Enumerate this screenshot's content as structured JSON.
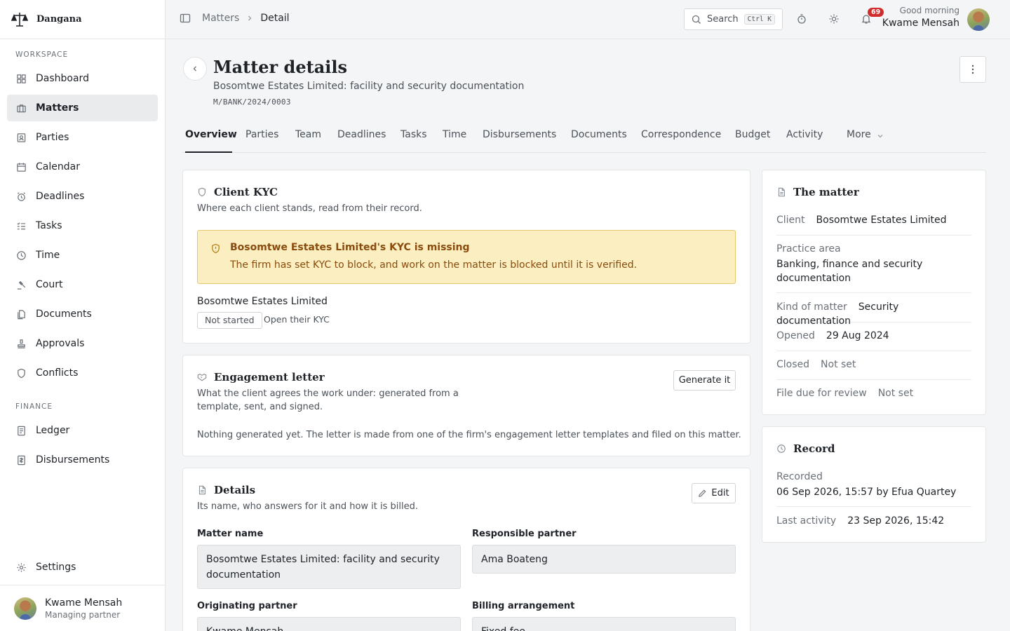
{
  "brand": {
    "name": "Dangana"
  },
  "sidebar": {
    "section_workspace": "WORKSPACE",
    "section_finance": "FINANCE",
    "items": [
      {
        "label": "Dashboard",
        "icon": "grid-icon"
      },
      {
        "label": "Matters",
        "icon": "briefcase-icon"
      },
      {
        "label": "Parties",
        "icon": "contact-icon"
      },
      {
        "label": "Calendar",
        "icon": "calendar-icon"
      },
      {
        "label": "Deadlines",
        "icon": "alarm-icon"
      },
      {
        "label": "Tasks",
        "icon": "list-check-icon"
      },
      {
        "label": "Time",
        "icon": "clock-icon"
      },
      {
        "label": "Court",
        "icon": "gavel-icon"
      },
      {
        "label": "Documents",
        "icon": "documents-icon"
      },
      {
        "label": "Approvals",
        "icon": "stamp-icon"
      },
      {
        "label": "Conflicts",
        "icon": "shield-icon"
      }
    ],
    "finance_items": [
      {
        "label": "Ledger",
        "icon": "ledger-icon"
      },
      {
        "label": "Disbursements",
        "icon": "receipt-icon"
      }
    ],
    "settings_label": "Settings",
    "user": {
      "name": "Kwame Mensah",
      "role": "Managing partner"
    }
  },
  "topbar": {
    "crumb_parent": "Matters",
    "crumb_current": "Detail",
    "search_label": "Search",
    "search_shortcut": "Ctrl K",
    "notification_count": "69",
    "greeting": "Good morning",
    "user_name": "Kwame Mensah"
  },
  "header": {
    "title": "Matter details",
    "subtitle": "Bosomtwe Estates Limited: facility and security documentation",
    "reference": "M/BANK/2024/0003"
  },
  "tabs": [
    "Overview",
    "Parties",
    "Team",
    "Deadlines",
    "Tasks",
    "Time",
    "Disbursements",
    "Documents",
    "Correspondence",
    "Budget",
    "Activity",
    "More"
  ],
  "kyc": {
    "title": "Client KYC",
    "description": "Where each client stands, read from their record.",
    "alert_title": "Bosomtwe Estates Limited's KYC is missing",
    "alert_text": "The firm has set KYC to block, and work on the matter is blocked until it is verified.",
    "client_name": "Bosomtwe Estates Limited",
    "status": "Not started",
    "open_link": "Open their KYC"
  },
  "engagement": {
    "title": "Engagement letter",
    "description_line1": "What the client agrees the work under: generated from a",
    "description_line2": "template, sent, and signed.",
    "generate_label": "Generate it",
    "empty_text": "Nothing generated yet. The letter is made from one of the firm's engagement letter templates and filed on this matter."
  },
  "details": {
    "title": "Details",
    "description": "Its name, who answers for it and how it is billed.",
    "edit_label": "Edit",
    "matter_name_label": "Matter name",
    "matter_name_value": "Bosomtwe Estates Limited: facility and security documentation",
    "responsible_label": "Responsible partner",
    "responsible_value": "Ama Boateng",
    "originating_label": "Originating partner",
    "originating_value": "Kwame Mensah",
    "billing_label": "Billing arrangement",
    "billing_value": "Fixed fee"
  },
  "the_matter": {
    "title": "The matter",
    "client_k": "Client",
    "client_v": "Bosomtwe Estates Limited",
    "practice_k": "Practice area",
    "practice_v": "Banking, finance and security documentation",
    "kind_k": "Kind of matter",
    "kind_v": "Security documentation",
    "opened_k": "Opened",
    "opened_v": "29 Aug 2024",
    "closed_k": "Closed",
    "closed_v": "Not set",
    "review_k": "File due for review",
    "review_v": "Not set"
  },
  "record": {
    "title": "Record",
    "recorded_k": "Recorded",
    "recorded_v": "06 Sep 2026, 15:57 by Efua Quartey",
    "last_k": "Last activity",
    "last_v": "23 Sep 2026, 15:42"
  },
  "colors": {
    "accent": "#1f2328",
    "warning_bg": "#fbefc2",
    "warning_text": "#8a4b0c",
    "badge": "#d12b2b"
  }
}
